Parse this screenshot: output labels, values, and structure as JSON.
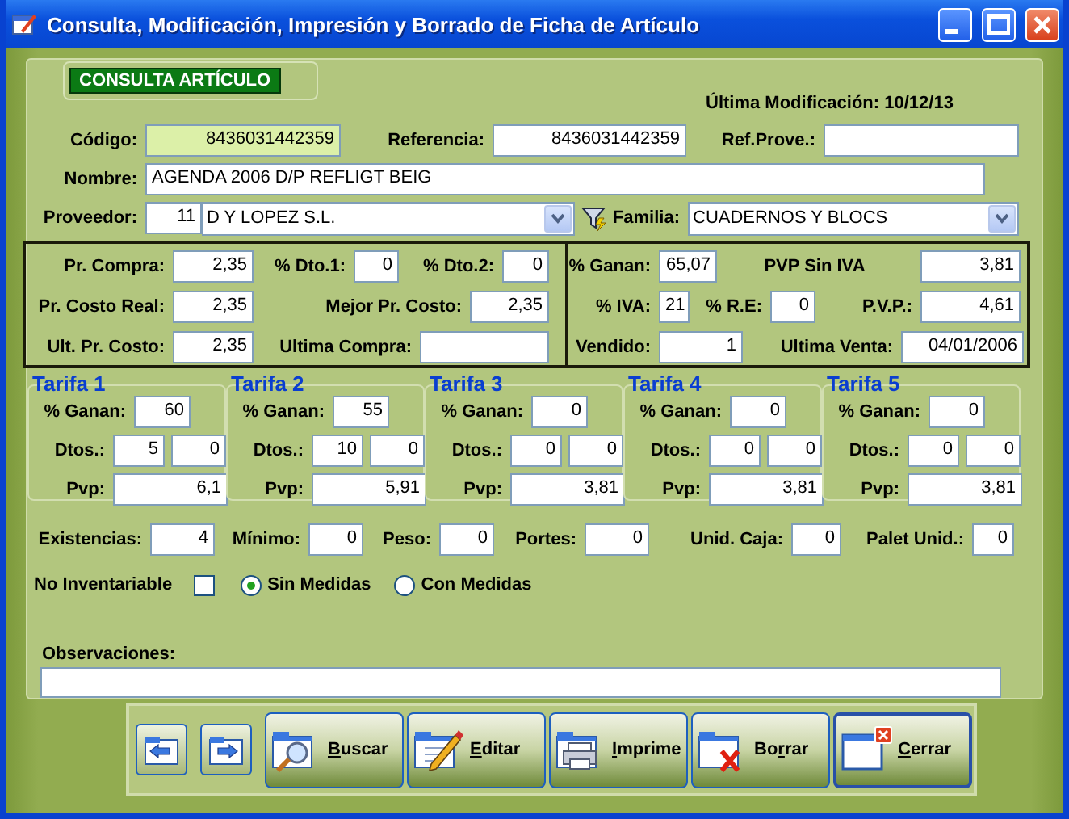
{
  "window": {
    "title": "Consulta, Modificación, Impresión y Borrado de Ficha de Artículo"
  },
  "tab": "CONSULTA ARTÍCULO",
  "last_modified": "Última Modificación: 10/12/13",
  "ids": [
    {
      "label": "Código:",
      "value": "8436031442359",
      "highlighted": true
    },
    {
      "label": "Referencia:",
      "value": "8436031442359",
      "highlighted": false
    },
    {
      "label": "Ref.Prove.:",
      "highlighted": false
    }
  ],
  "nombre": {
    "label": "Nombre:",
    "value": "AGENDA 2006 D/P REFLIGT BEIG"
  },
  "proveedor": {
    "label": "Proveedor:",
    "code": "11",
    "value": "D Y LOPEZ S.L."
  },
  "familia": {
    "label": "Familia:",
    "value": "CUADERNOS Y BLOCS"
  },
  "costs_left": [
    [
      {
        "label": "Pr. Compra:",
        "value": "2,35"
      },
      {
        "label": "% Dto.1:",
        "value": "0"
      },
      {
        "label": "% Dto.2:",
        "value": "0"
      }
    ],
    [
      {
        "label": "Pr. Costo Real:",
        "value": "2,35"
      },
      {
        "label": "Mejor Pr. Costo:",
        "value": "2,35"
      }
    ],
    [
      {
        "label": "Ult. Pr. Costo:",
        "value": "2,35"
      },
      {
        "label": "Ultima Compra:"
      }
    ]
  ],
  "costs_right": [
    [
      {
        "label": "% Ganan:",
        "value": "65,07"
      },
      {
        "label": "PVP Sin IVA",
        "value": "3,81"
      }
    ],
    [
      {
        "label": "% IVA:",
        "value": "21"
      },
      {
        "label": "% R.E:",
        "value": "0"
      },
      {
        "label": "P.V.P.:",
        "value": "4,61"
      }
    ],
    [
      {
        "label": "Vendido:",
        "value": "1"
      },
      {
        "label": "Ultima Venta:",
        "value": "04/01/2006"
      }
    ]
  ],
  "tarifas": [
    {
      "title": "Tarifa 1",
      "ganan_label": "% Ganan:",
      "ganan": "60",
      "dtos_label": "Dtos.:",
      "dtos": [
        "5",
        "0"
      ],
      "pvp_label": "Pvp:",
      "pvp": "6,1"
    },
    {
      "title": "Tarifa 2",
      "ganan_label": "% Ganan:",
      "ganan": "55",
      "dtos_label": "Dtos.:",
      "dtos": [
        "10",
        "0"
      ],
      "pvp_label": "Pvp:",
      "pvp": "5,91"
    },
    {
      "title": "Tarifa 3",
      "ganan_label": "% Ganan:",
      "ganan": "0",
      "dtos_label": "Dtos.:",
      "dtos": [
        "0",
        "0"
      ],
      "pvp_label": "Pvp:",
      "pvp": "3,81"
    },
    {
      "title": "Tarifa 4",
      "ganan_label": "% Ganan:",
      "ganan": "0",
      "dtos_label": "Dtos.:",
      "dtos": [
        "0",
        "0"
      ],
      "pvp_label": "Pvp:",
      "pvp": "3,81"
    },
    {
      "title": "Tarifa 5",
      "ganan_label": "% Ganan:",
      "ganan": "0",
      "dtos_label": "Dtos.:",
      "dtos": [
        "0",
        "0"
      ],
      "pvp_label": "Pvp:",
      "pvp": "3,81"
    }
  ],
  "stock": [
    {
      "label": "Existencias:",
      "value": "4"
    },
    {
      "label": "Mínimo:",
      "value": "0"
    },
    {
      "label": "Peso:",
      "value": "0"
    },
    {
      "label": "Portes:",
      "value": "0"
    },
    {
      "label": "Unid. Caja:",
      "value": "0"
    },
    {
      "label": "Palet Unid.:",
      "value": "0"
    }
  ],
  "no_inventariable": {
    "label": "No Inventariable",
    "checked": false
  },
  "medidas": [
    {
      "label": "Sin Medidas",
      "selected": true
    },
    {
      "label": "Con Medidas",
      "selected": false
    }
  ],
  "observaciones": {
    "label": "Observaciones:"
  },
  "nav_buttons": [
    {
      "kind": "prev"
    },
    {
      "kind": "next"
    }
  ],
  "buttons": [
    {
      "kind": "search",
      "key": "B",
      "post": "uscar",
      "focused": false
    },
    {
      "kind": "edit",
      "key": "E",
      "post": "ditar",
      "focused": false
    },
    {
      "kind": "print",
      "key": "I",
      "post": "mprime",
      "focused": false
    },
    {
      "kind": "delete",
      "pre": "Bo",
      "key": "r",
      "post": "rar",
      "focused": false
    },
    {
      "kind": "close",
      "key": "C",
      "post": "errar",
      "focused": true
    }
  ]
}
